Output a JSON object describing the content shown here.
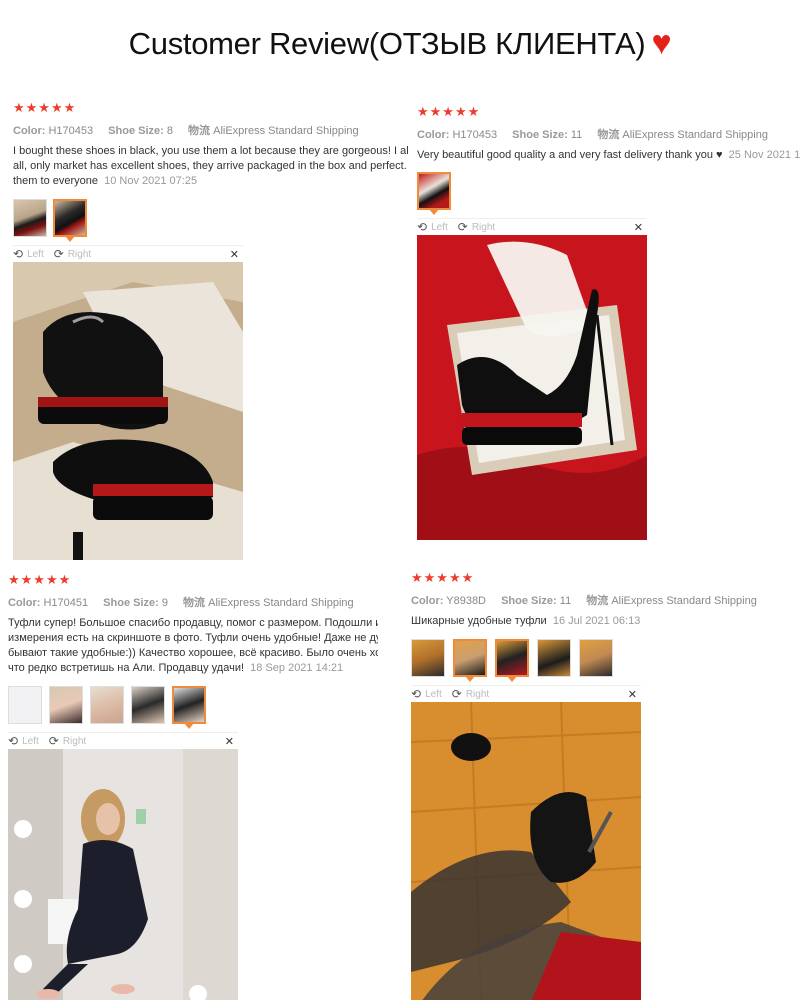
{
  "page_title": "Customer Review(ОТЗЫВ КЛИЕНТА)",
  "heart_icon": "heart-icon",
  "labels": {
    "color": "Color:",
    "shoe_size": "Shoe Size:",
    "shipping": "物流",
    "left": "Left",
    "right": "Right"
  },
  "reviews": [
    {
      "stars": "★★★★★",
      "color": "H170453",
      "shoe_size": "8",
      "shipping": "AliExpress Standard Shipping",
      "lines": [
        "I bought these shoes in black, you use them a lot because they are gorgeous! I als",
        "all, only market has excellent shoes, they arrive packaged in the box and perfect."
      ],
      "last_line": "them to everyone",
      "date": "10 Nov 2021 07:25"
    },
    {
      "stars": "★★★★★",
      "color": "H170453",
      "shoe_size": "11",
      "shipping": "AliExpress Standard Shipping",
      "lines": [],
      "last_line": "Very beautiful good quality a and very fast delivery thank you ♥",
      "date": "25 Nov 2021 1"
    },
    {
      "stars": "★★★★★",
      "color": "H170451",
      "shoe_size": "9",
      "shipping": "AliExpress Standard Shipping",
      "lines": [
        "Туфли супер! Большое спасибо продавцу, помог с размером. Подошли и",
        "измерения есть на скриншоте в фото. Туфли очень удобные! Даже не ду",
        "бывают такие удобные:)) Качество хорошее, всё красиво. Было очень хо"
      ],
      "last_line": "что редко встретишь на Али. Продавцу удачи!",
      "date": "18 Sep 2021 14:21"
    },
    {
      "stars": "★★★★★",
      "color": "Y8938D",
      "shoe_size": "11",
      "shipping": "AliExpress Standard Shipping",
      "lines": [],
      "last_line": "Шикарные удобные туфли",
      "date": "16 Jul 2021 06:13"
    }
  ]
}
